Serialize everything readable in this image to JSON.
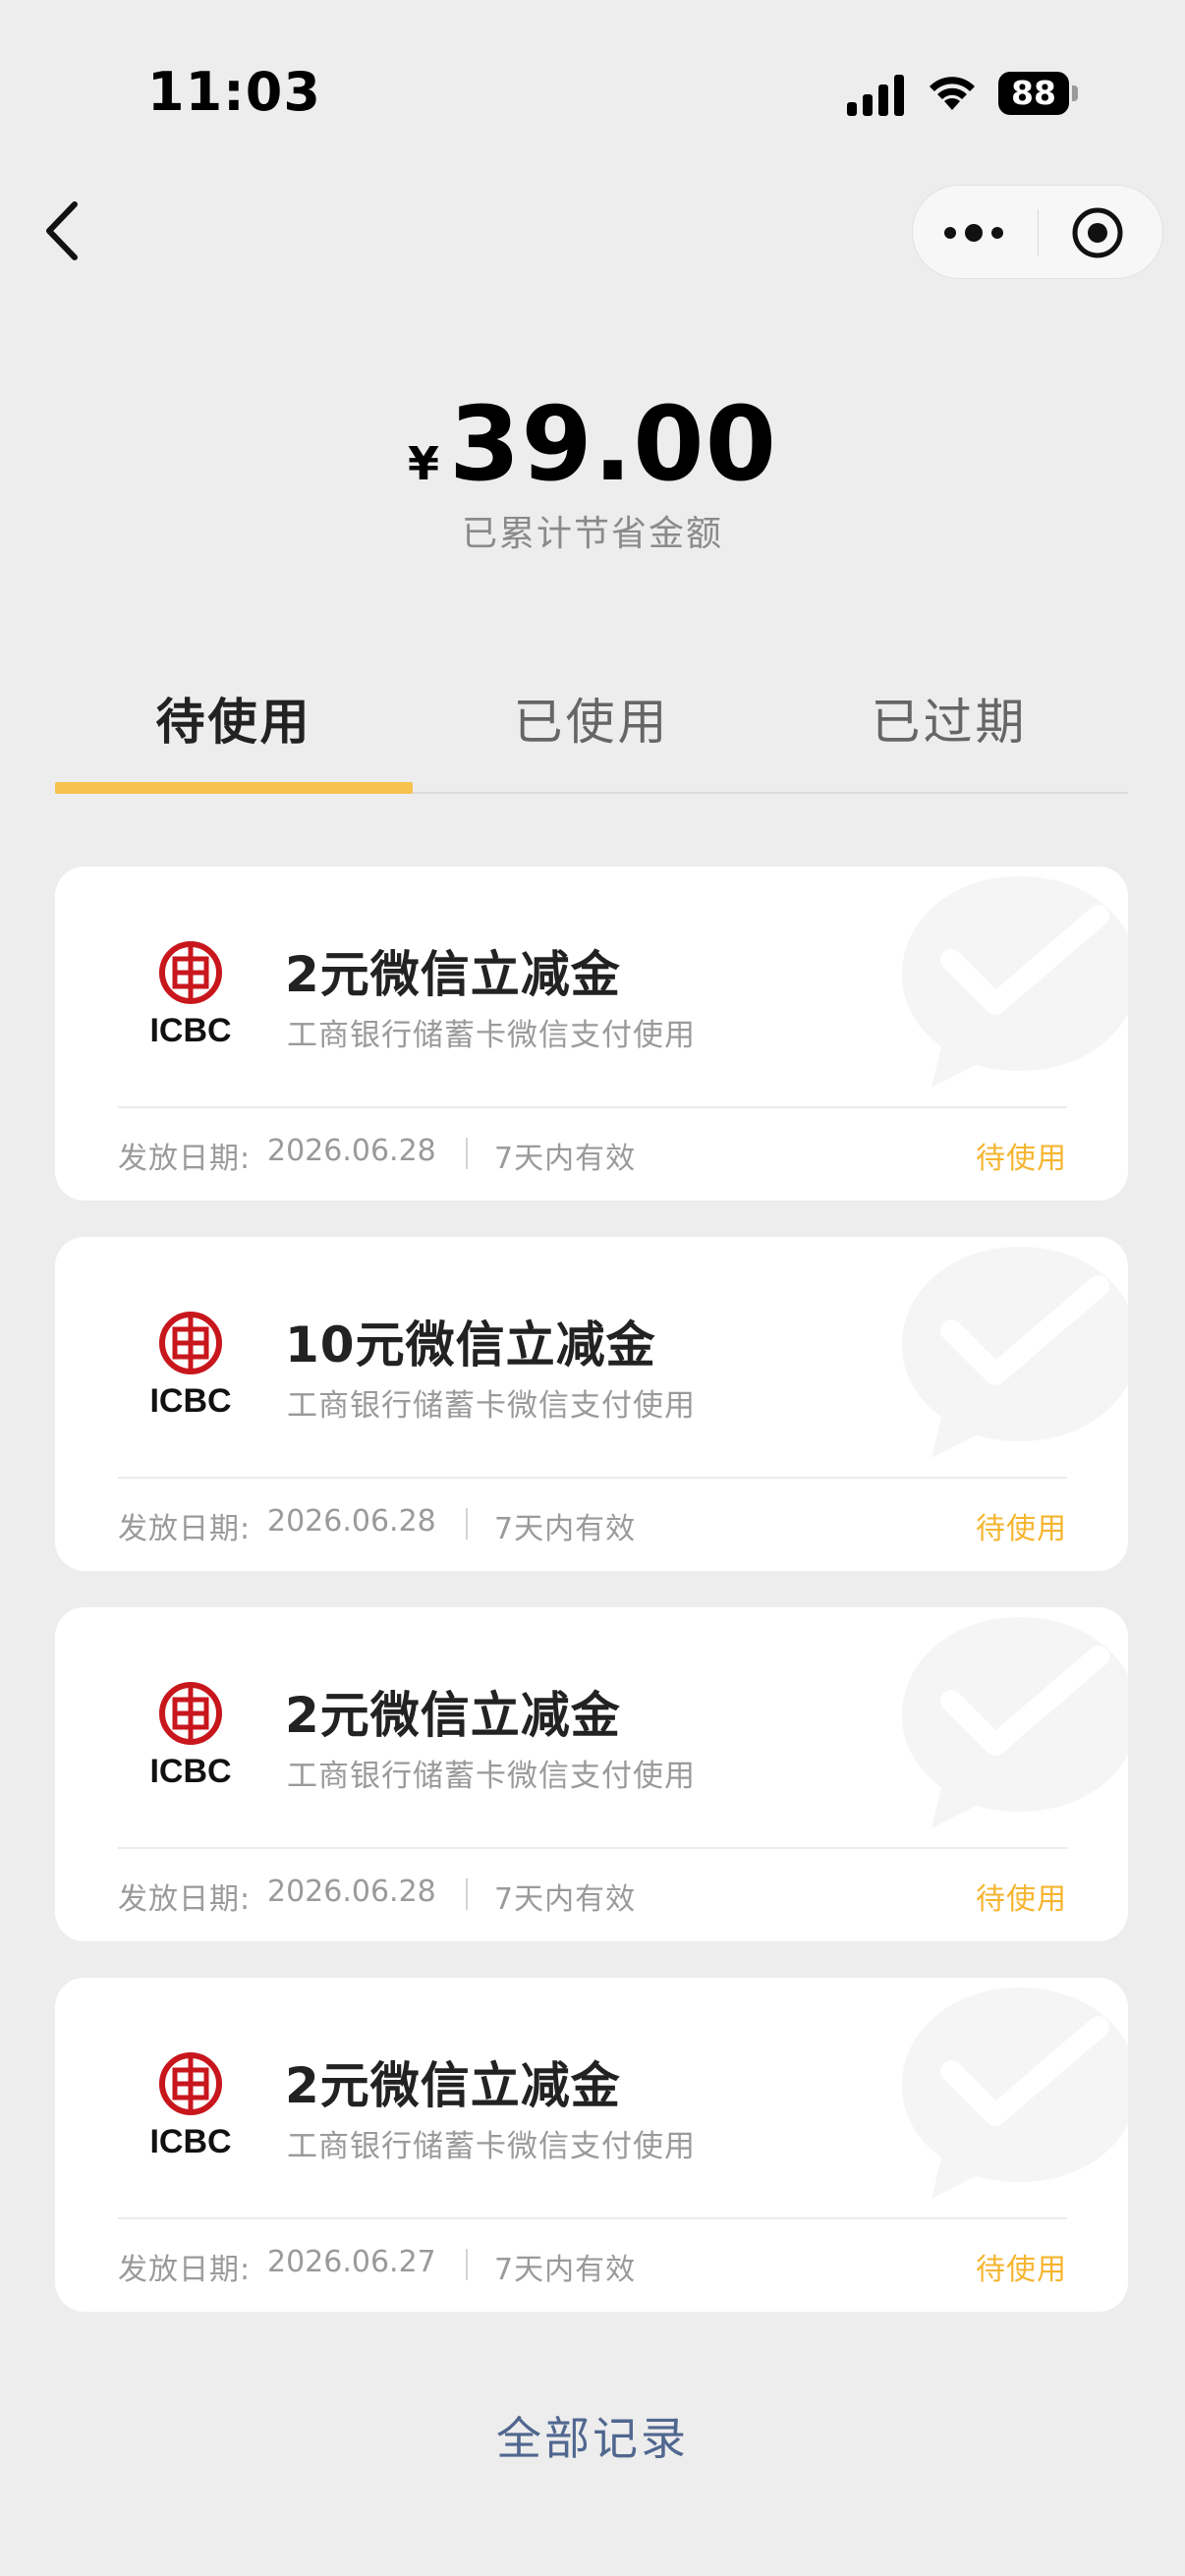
{
  "status_bar": {
    "time": "11:03",
    "battery": "88"
  },
  "nav": {
    "icons": [
      "back-chevron-icon",
      "more-dots-icon",
      "close-target-icon"
    ]
  },
  "savings": {
    "currency": "¥",
    "amount": "39.00",
    "label": "已累计节省金额"
  },
  "tabs": [
    {
      "label": "待使用",
      "active": true
    },
    {
      "label": "已使用",
      "active": false
    },
    {
      "label": "已过期",
      "active": false
    }
  ],
  "colors": {
    "accent": "#f6c34f",
    "status_text": "#f5b52f",
    "link": "#50678f",
    "icbc_red": "#c8161d"
  },
  "coupons": [
    {
      "bank": "ICBC",
      "title": "2元微信立减金",
      "subtitle": "工商银行储蓄卡微信支付使用",
      "issue_label": "发放日期:",
      "issue_date": "2026.06.28",
      "validity": "7天内有效",
      "status": "待使用"
    },
    {
      "bank": "ICBC",
      "title": "10元微信立减金",
      "subtitle": "工商银行储蓄卡微信支付使用",
      "issue_label": "发放日期:",
      "issue_date": "2026.06.28",
      "validity": "7天内有效",
      "status": "待使用"
    },
    {
      "bank": "ICBC",
      "title": "2元微信立减金",
      "subtitle": "工商银行储蓄卡微信支付使用",
      "issue_label": "发放日期:",
      "issue_date": "2026.06.28",
      "validity": "7天内有效",
      "status": "待使用"
    },
    {
      "bank": "ICBC",
      "title": "2元微信立减金",
      "subtitle": "工商银行储蓄卡微信支付使用",
      "issue_label": "发放日期:",
      "issue_date": "2026.06.27",
      "validity": "7天内有效",
      "status": "待使用"
    }
  ],
  "footer": {
    "all_records": "全部记录"
  }
}
